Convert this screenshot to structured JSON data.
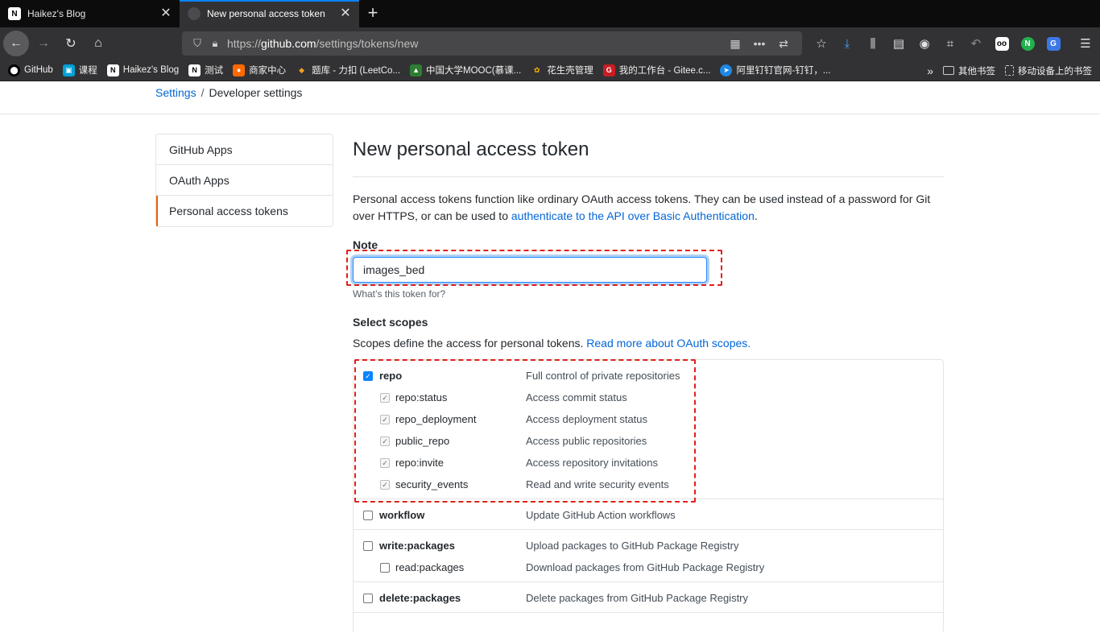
{
  "browser": {
    "tabs": [
      {
        "title": "Haikez's Blog",
        "favicon": "N",
        "active": false
      },
      {
        "title": "New personal access token",
        "favicon": "",
        "active": true
      }
    ],
    "url_prefix": "https://",
    "url_host": "github.com",
    "url_path": "/settings/tokens/new",
    "bookmarks": [
      {
        "label": "GitHub",
        "icon": "github-icon",
        "color": "#000000",
        "glyph": "⬤"
      },
      {
        "label": "课程",
        "icon": "tv-icon",
        "color": "#00a1d6",
        "glyph": "▣"
      },
      {
        "label": "Haikez's Blog",
        "icon": "notion-icon",
        "color": "#ffffff",
        "glyph": "N"
      },
      {
        "label": "测试",
        "icon": "notion-icon",
        "color": "#ffffff",
        "glyph": "N"
      },
      {
        "label": "商家中心",
        "icon": "shop-icon",
        "color": "#ff6a00",
        "glyph": "●"
      },
      {
        "label": "题库 - 力扣 (LeetCo...",
        "icon": "leetcode-icon",
        "color": "#f89f1b",
        "glyph": "◆"
      },
      {
        "label": "中国大学MOOC(慕课...",
        "icon": "mooc-icon",
        "color": "#2e7d32",
        "glyph": "▲"
      },
      {
        "label": "花生壳管理",
        "icon": "peanut-icon",
        "color": "#1e88e5",
        "glyph": "✿"
      },
      {
        "label": "我的工作台 - Gitee.c...",
        "icon": "gitee-icon",
        "color": "#c71d23",
        "glyph": "G"
      },
      {
        "label": "阿里钉钉官网-钉钉，...",
        "icon": "dingtalk-icon",
        "color": "#1e88e5",
        "glyph": "➤"
      }
    ],
    "bookmarks_right": [
      {
        "label": "其他书签",
        "icon": "folder-icon"
      },
      {
        "label": "移动设备上的书签",
        "icon": "mobile-icon"
      }
    ]
  },
  "breadcrumb": {
    "settings": "Settings",
    "separator": "/",
    "developer": "Developer settings"
  },
  "sidebar": {
    "items": [
      {
        "label": "GitHub Apps"
      },
      {
        "label": "OAuth Apps"
      },
      {
        "label": "Personal access tokens"
      }
    ]
  },
  "main": {
    "title": "New personal access token",
    "intro_text": "Personal access tokens function like ordinary OAuth access tokens. They can be used instead of a password for Git over HTTPS, or can be used to ",
    "intro_link": "authenticate to the API over Basic Authentication",
    "intro_end": ".",
    "note_label": "Note",
    "note_value": "images_bed",
    "note_hint": "What’s this token for?",
    "scopes_label": "Select scopes",
    "scopes_desc": "Scopes define the access for personal tokens. ",
    "scopes_link": "Read more about OAuth scopes."
  },
  "scopes": [
    {
      "name": "repo",
      "desc": "Full control of private repositories",
      "checked": true,
      "children": [
        {
          "name": "repo:status",
          "desc": "Access commit status",
          "checked": true
        },
        {
          "name": "repo_deployment",
          "desc": "Access deployment status",
          "checked": true
        },
        {
          "name": "public_repo",
          "desc": "Access public repositories",
          "checked": true
        },
        {
          "name": "repo:invite",
          "desc": "Access repository invitations",
          "checked": true
        },
        {
          "name": "security_events",
          "desc": "Read and write security events",
          "checked": true
        }
      ]
    },
    {
      "name": "workflow",
      "desc": "Update GitHub Action workflows",
      "checked": false,
      "children": []
    },
    {
      "name": "write:packages",
      "desc": "Upload packages to GitHub Package Registry",
      "checked": false,
      "children": [
        {
          "name": "read:packages",
          "desc": "Download packages from GitHub Package Registry",
          "checked": false
        }
      ]
    },
    {
      "name": "delete:packages",
      "desc": "Delete packages from GitHub Package Registry",
      "checked": false,
      "children": []
    }
  ],
  "colors": {
    "accent_link": "#0366d6",
    "highlight_red": "#e0201b",
    "checkbox_blue": "#0a84ff"
  }
}
